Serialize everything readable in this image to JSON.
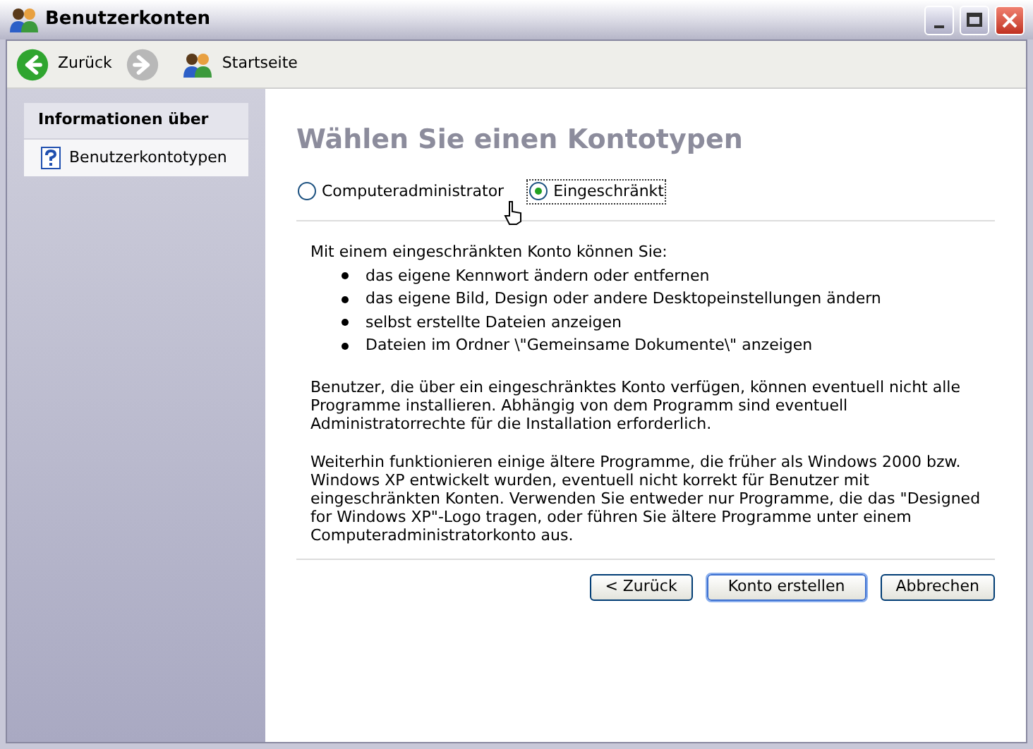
{
  "window": {
    "title": "Benutzerkonten"
  },
  "toolbar": [
    {
      "kind": "back",
      "label": "Zurück",
      "disabled": false
    },
    {
      "kind": "forward",
      "disabled": true
    },
    {
      "kind": "home",
      "label": "Startseite",
      "disabled": false
    }
  ],
  "sidebar": {
    "title": "Informationen über",
    "items": [
      {
        "label": "Benutzerkontotypen"
      }
    ]
  },
  "main": {
    "heading": "Wählen Sie einen Kontotypen",
    "options": [
      {
        "label": "Computeradministrator",
        "selected": false
      },
      {
        "label": "Eingeschränkt",
        "selected": true
      }
    ],
    "intro": "Mit einem eingeschränkten Konto können Sie:",
    "bullets": [
      "das eigene Kennwort ändern oder entfernen",
      "das eigene Bild, Design oder andere Desktopeinstellungen ändern",
      "selbst erstellte Dateien anzeigen",
      "Dateien im Ordner \\\"Gemeinsame Dokumente\\\" anzeigen"
    ],
    "paragraphs": [
      "Benutzer, die über ein eingeschränktes Konto verfügen, können eventuell nicht alle Programme installieren. Abhängig von dem Programm sind eventuell Administratorrechte für die Installation erforderlich.",
      "Weiterhin funktionieren einige ältere Programme, die früher als Windows 2000 bzw. Windows XP entwickelt wurden, eventuell nicht korrekt für Benutzer mit eingeschränkten Konten. Verwenden Sie entweder nur Programme, die das \"Designed for Windows XP\"-Logo tragen, oder führen Sie ältere Programme unter einem Computeradministratorkonto aus."
    ],
    "buttons": [
      {
        "label": "< Zurück",
        "default": false
      },
      {
        "label": "Konto erstellen",
        "default": true
      },
      {
        "label": "Abbrechen",
        "default": false
      }
    ]
  }
}
